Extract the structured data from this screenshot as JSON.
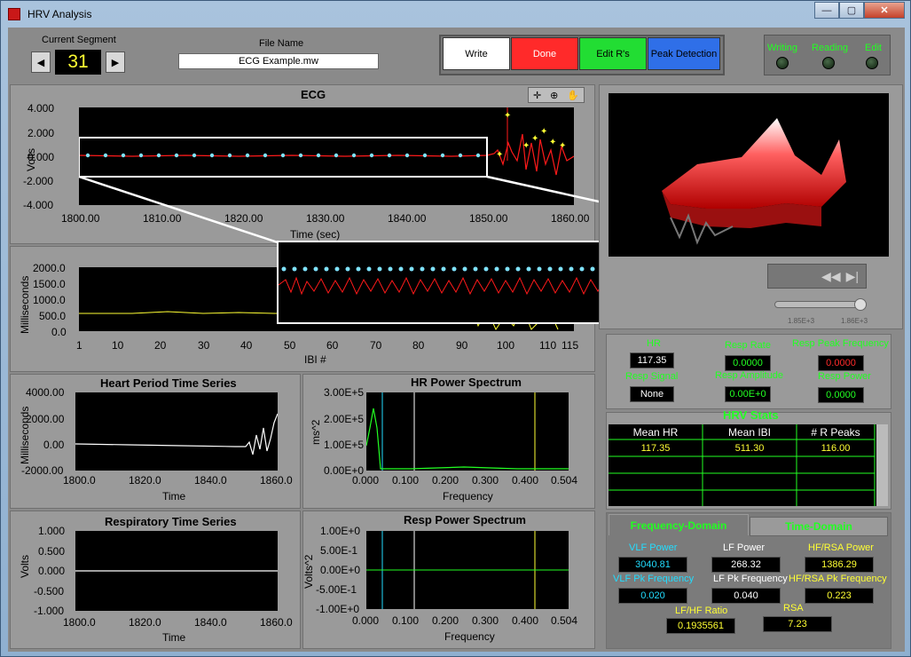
{
  "window": {
    "title": "HRV Analysis",
    "min": "—",
    "max": "▢",
    "close": "✕"
  },
  "segment": {
    "label": "Current Segment",
    "value": "31",
    "prev": "◀",
    "next": "▶"
  },
  "file": {
    "label": "File Name",
    "value": "ECG Example.mw"
  },
  "buttons": {
    "write": "Write",
    "done": "Done",
    "edit_rs": "Edit R's",
    "peak": "Peak Detection"
  },
  "leds": {
    "writing": "Writing",
    "reading": "Reading",
    "edit": "Edit"
  },
  "ecg": {
    "title": "ECG",
    "ylabel": "Volts",
    "xlabel": "Time (sec)",
    "yticks": [
      "4.000",
      "2.000",
      "0.000",
      "-2.000",
      "-4.000"
    ],
    "xticks": [
      "1800.00",
      "1810.00",
      "1820.00",
      "1830.00",
      "1840.00",
      "1850.00",
      "1860.00"
    ]
  },
  "ibi": {
    "ylabel": "Milliseconds",
    "xlabel": "IBI #",
    "yticks": [
      "2000.0",
      "1500.0",
      "1000.0",
      "500.0",
      "0.0"
    ],
    "xticks": [
      "1",
      "10",
      "20",
      "30",
      "40",
      "50",
      "60",
      "70",
      "80",
      "90",
      "100",
      "110",
      "115"
    ]
  },
  "hp": {
    "title": "Heart Period Time Series",
    "ylabel": "Milliseconds",
    "xlabel": "Time",
    "yticks": [
      "4000.00",
      "2000.00",
      "0.00",
      "-2000.00"
    ],
    "xticks": [
      "1800.0",
      "1820.0",
      "1840.0",
      "1860.0"
    ]
  },
  "hrps": {
    "title": "HR Power Spectrum",
    "ylabel": "ms^2",
    "xlabel": "Frequency",
    "yticks": [
      "3.00E+5",
      "2.00E+5",
      "1.00E+5",
      "0.00E+0"
    ],
    "xticks": [
      "0.000",
      "0.100",
      "0.200",
      "0.300",
      "0.400",
      "0.504"
    ]
  },
  "resp": {
    "title": "Respiratory Time Series",
    "ylabel": "Volts",
    "xlabel": "Time",
    "yticks": [
      "1.000",
      "0.500",
      "0.000",
      "-0.500",
      "-1.000"
    ],
    "xticks": [
      "1800.0",
      "1820.0",
      "1840.0",
      "1860.0"
    ]
  },
  "rps": {
    "title": "Resp Power Spectrum",
    "ylabel": "Volts^2",
    "xlabel": "Frequency",
    "yticks": [
      "1.00E+0",
      "5.00E-1",
      "0.00E+0",
      "-5.00E-1",
      "-1.00E+0"
    ],
    "xticks": [
      "0.000",
      "0.100",
      "0.200",
      "0.300",
      "0.400",
      "0.504"
    ]
  },
  "slider": {
    "ticks": [
      "1.85E+3",
      "1.86E+3"
    ]
  },
  "stats": {
    "hr_label": "HR",
    "hr": "117.35",
    "resp_rate_label": "Resp Rate",
    "resp_rate": "0.0000",
    "resp_peak_label": "Resp Peak Frequency",
    "resp_peak": "0.0000",
    "resp_signal_label": "Resp Signal",
    "resp_signal": "None",
    "resp_amp_label": "Resp Amplitude",
    "resp_amp": "0.00E+0",
    "resp_power_label": "Resp Power",
    "resp_power": "0.0000"
  },
  "hrv": {
    "title": "HRV Stats",
    "headers": [
      "Mean HR",
      "Mean IBI",
      "# R Peaks"
    ],
    "row": [
      "117.35",
      "511.30",
      "116.00"
    ]
  },
  "freq": {
    "tab1": "Frequency-Domain",
    "tab2": "Time-Domain",
    "vlf_power_label": "VLF  Power",
    "vlf_power": "3040.81",
    "lf_power_label": "LF Power",
    "lf_power": "268.32",
    "hf_power_label": "HF/RSA Power",
    "hf_power": "1386.29",
    "vlf_pk_label": "VLF Pk Frequency",
    "vlf_pk": "0.020",
    "lf_pk_label": "LF Pk Frequency",
    "lf_pk": "0.040",
    "hf_pk_label": "HF/RSA Pk Frequency",
    "hf_pk": "0.223",
    "lfhf_label": "LF/HF Ratio",
    "lfhf": "0.1935561",
    "rsa_label": "RSA",
    "rsa": "7.23"
  },
  "colors": {
    "trace_red": "#ff1a1a",
    "dots": "#7fe3ff",
    "yellow": "#ffff33",
    "green": "#22ff22",
    "cyan": "#22ddff",
    "write_btn": "#ffffff",
    "done_btn": "#ff2a2a",
    "edit_btn": "#22dd33",
    "peak_btn": "#2f6fe8"
  }
}
